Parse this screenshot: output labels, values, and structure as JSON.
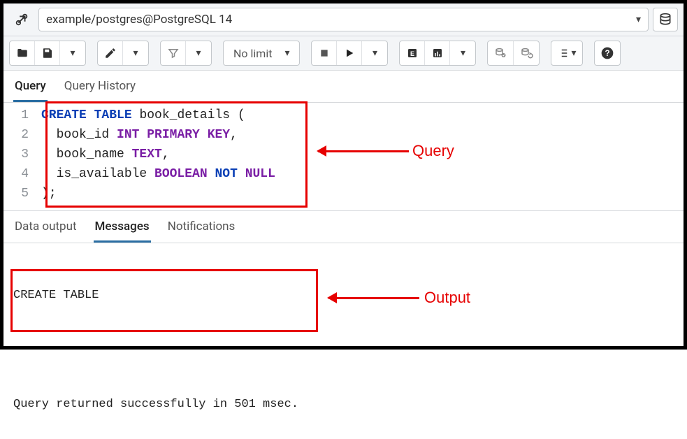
{
  "connection": {
    "label": "example/postgres@PostgreSQL 14"
  },
  "toolbar": {
    "limit_label": "No limit"
  },
  "editor_tabs": {
    "query": "Query",
    "history": "Query History"
  },
  "code": {
    "lines": [
      "1",
      "2",
      "3",
      "4",
      "5"
    ],
    "l1_kw1": "CREATE",
    "l1_kw2": "TABLE",
    "l1_rest": " book_details (",
    "l2_pre": "  book_id ",
    "l2_type": "INT",
    "l2_sp": " ",
    "l2_pk1": "PRIMARY",
    "l2_pk2": "KEY",
    "l2_end": ",",
    "l3_pre": "  book_name ",
    "l3_type": "TEXT",
    "l3_end": ",",
    "l4_pre": "  is_available ",
    "l4_type": "BOOLEAN",
    "l4_sp": " ",
    "l4_not": "NOT",
    "l4_sp2": " ",
    "l4_null": "NULL",
    "l5": ");"
  },
  "output_tabs": {
    "data": "Data output",
    "messages": "Messages",
    "notifications": "Notifications"
  },
  "messages": {
    "line1": "CREATE TABLE",
    "line2": "Query returned successfully in 501 msec."
  },
  "annotations": {
    "query": "Query",
    "output": "Output"
  }
}
